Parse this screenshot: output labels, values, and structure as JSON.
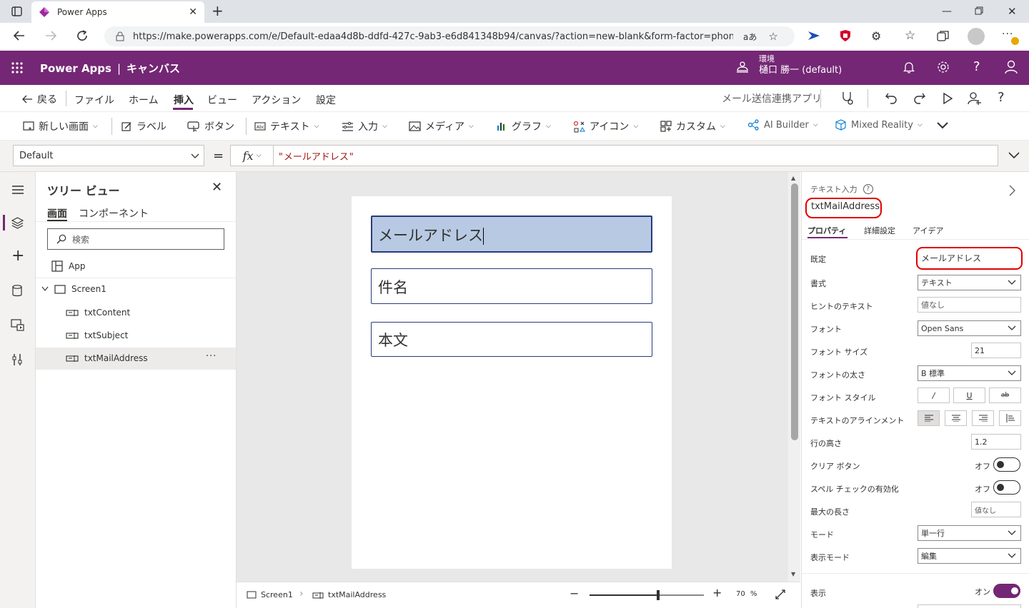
{
  "browser": {
    "tab_title": "Power Apps",
    "url": "https://make.powerapps.com/e/Default-edaa4d8b-ddfd-427c-9ab3-e6d841348b94/canvas/?action=new-blank&form-factor=phone&...",
    "reader_label": "aあ"
  },
  "header": {
    "app_name": "Power Apps",
    "separator": "|",
    "section": "キャンバス",
    "env_label": "環境",
    "env_name": "樋口 勝一 (default)"
  },
  "menu": {
    "back": "戻る",
    "items": [
      "ファイル",
      "ホーム",
      "挿入",
      "ビュー",
      "アクション",
      "設定"
    ],
    "app_title": "メール送信連携アプリ"
  },
  "insert_toolbar": {
    "items": [
      "新しい画面",
      "ラベル",
      "ボタン",
      "テキスト",
      "入力",
      "メディア",
      "グラフ",
      "アイコン",
      "カスタム",
      "AI Builder",
      "Mixed Reality"
    ]
  },
  "formula": {
    "property": "Default",
    "equals": "=",
    "fx": "fx",
    "value": "\"メールアドレス\""
  },
  "tree": {
    "title": "ツリー ビュー",
    "tabs": [
      "画面",
      "コンポーネント"
    ],
    "search_placeholder": "検索",
    "app": "App",
    "screen": "Screen1",
    "children": [
      "txtContent",
      "txtSubject",
      "txtMailAddress"
    ],
    "more": "···"
  },
  "canvas": {
    "inputs": [
      "メールアドレス",
      "件名",
      "本文"
    ]
  },
  "status": {
    "screen": "Screen1",
    "control": "txtMailAddress",
    "zoom": "70",
    "zoom_unit": "%",
    "zoom_level": 0.6
  },
  "properties": {
    "control_type": "テキスト入力",
    "control_name": "txtMailAddress",
    "tabs": [
      "プロパティ",
      "詳細設定",
      "アイデア"
    ],
    "rows": {
      "default_label": "既定",
      "default_value": "メールアドレス",
      "format_label": "書式",
      "format_value": "テキスト",
      "hint_label": "ヒントのテキスト",
      "hint_placeholder": "値なし",
      "font_label": "フォント",
      "font_value": "Open Sans",
      "size_label": "フォント サイズ",
      "size_value": "21",
      "weight_label": "フォントの太さ",
      "weight_value": "B 標準",
      "style_label": "フォント スタイル",
      "style_italic": "/",
      "style_underline": "U",
      "style_strike": "ab",
      "align_label": "テキストのアラインメント",
      "lineheight_label": "行の高さ",
      "lineheight_value": "1.2",
      "clear_label": "クリア ボタン",
      "clear_value": "オフ",
      "spell_label": "スペル チェックの有効化",
      "spell_value": "オフ",
      "maxlen_label": "最大の長さ",
      "maxlen_placeholder": "値なし",
      "mode_label": "モード",
      "mode_value": "単一行",
      "display_label": "表示モード",
      "display_value": "編集",
      "visible_label": "表示",
      "visible_value": "オン"
    }
  },
  "colors": {
    "brand": "#742774",
    "highlight_red": "#e00000",
    "input_border": "#2a3a7a",
    "selected_fill": "#b8cae3"
  }
}
